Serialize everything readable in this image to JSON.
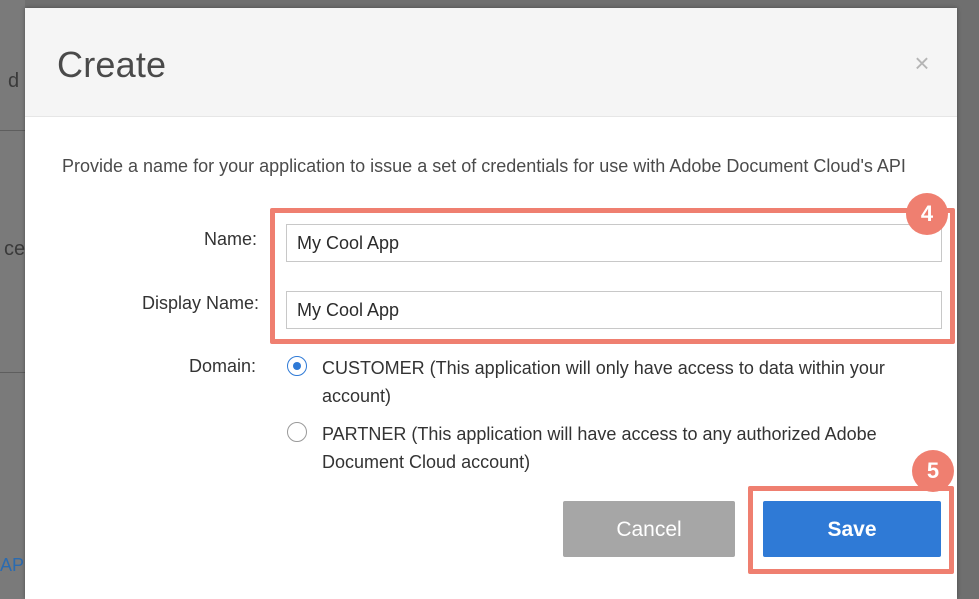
{
  "background": {
    "fragments": [
      "d",
      "ce",
      "AP"
    ]
  },
  "modal": {
    "title": "Create",
    "close_icon": "×",
    "description": "Provide a name for your application to issue a set of credentials for use with Adobe Document Cloud's API"
  },
  "form": {
    "name_label": "Name:",
    "name_value": "My Cool App",
    "display_name_label": "Display Name:",
    "display_name_value": "My Cool App",
    "domain_label": "Domain:",
    "domain_options": [
      {
        "label": "CUSTOMER (This application will only have access to data within your account)",
        "selected": true
      },
      {
        "label": "PARTNER (This application will have access to any authorized Adobe Document Cloud account)",
        "selected": false
      }
    ]
  },
  "annotations": {
    "step_inputs": "4",
    "step_save": "5",
    "highlight_color": "#ef7f70"
  },
  "buttons": {
    "cancel_label": "Cancel",
    "save_label": "Save"
  },
  "colors": {
    "primary": "#2f7ad6",
    "cancel": "#a6a6a6"
  }
}
